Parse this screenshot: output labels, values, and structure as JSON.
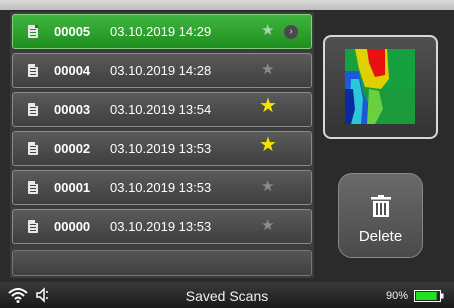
{
  "scans": [
    {
      "id": "00005",
      "date": "03.10.2019 14:29",
      "favorite": false,
      "selected": true
    },
    {
      "id": "00004",
      "date": "03.10.2019 14:28",
      "favorite": false,
      "selected": false
    },
    {
      "id": "00003",
      "date": "03.10.2019 13:54",
      "favorite": true,
      "selected": false
    },
    {
      "id": "00002",
      "date": "03.10.2019 13:53",
      "favorite": true,
      "selected": false
    },
    {
      "id": "00001",
      "date": "03.10.2019 13:53",
      "favorite": false,
      "selected": false
    },
    {
      "id": "00000",
      "date": "03.10.2019 13:53",
      "favorite": false,
      "selected": false
    }
  ],
  "icons": {
    "file": "document-icon",
    "star": "star-icon",
    "open": "chevron-right-icon",
    "delete": "trash-icon",
    "wifi": "wifi-icon",
    "speaker": "speaker-icon",
    "battery": "battery-icon"
  },
  "delete_button": {
    "label": "Delete"
  },
  "status_bar": {
    "title": "Saved Scans",
    "battery_level": "90%"
  },
  "colors": {
    "selected_row": "#2aa82a",
    "favorite_star": "#f5e400",
    "battery": "#22e022"
  }
}
